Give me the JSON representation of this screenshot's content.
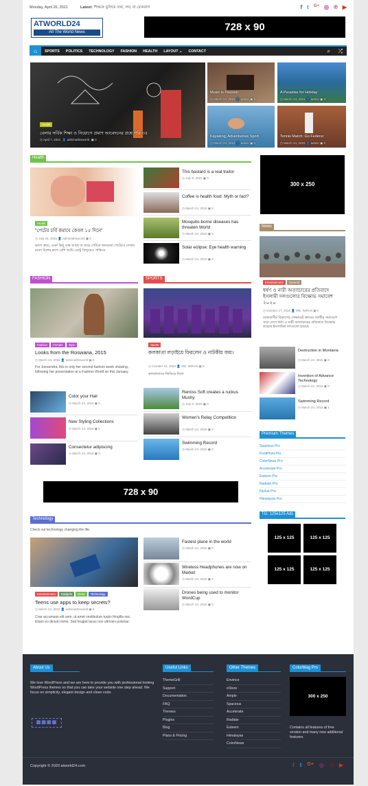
{
  "topbar": {
    "date": "Monday, April 26, 2021",
    "latest_label": "Latest:",
    "latest_text": "শিক্ষকে ভুলিয়ে তথ্য, লন, রা চ্যেকবাল"
  },
  "logo": {
    "name": "ATWORLD24",
    "tagline": "All The World News"
  },
  "ads": {
    "top": "728 x 90",
    "mid": "728 x 90",
    "side": "300 x 250",
    "footer": "300 x 250",
    "small": "125 x 125"
  },
  "nav": {
    "items": [
      "SPORTS",
      "POLITICS",
      "TECHNOLOGY",
      "FASHION",
      "HEALTH",
      "LAYOUT ⌄",
      "CONTACT"
    ]
  },
  "hero": {
    "main": {
      "badge": "Health",
      "title": "বেলার সর্বিক শিক্ষা ও নিয়োগে প্রমাণ আবেদনের প্রশ্নে পরি ৩৫",
      "date": "April 7, 2021",
      "author": "adminathisworld",
      "comments": "0"
    },
    "tiles": [
      {
        "title": "Music is Passion",
        "date": "March 24, 2015",
        "author": "admin",
        "comments": "0"
      },
      {
        "title": "A Paradise for Holiday",
        "date": "March 24, 2015",
        "author": "admin",
        "comments": "0"
      },
      {
        "title": "Kayaking, Adventurous Sport",
        "date": "March 24, 2015",
        "author": "admin",
        "comments": "0"
      },
      {
        "title": "Tennis Match: Go Federer",
        "date": "March 24, 2015",
        "author": "admin",
        "comments": "0"
      }
    ]
  },
  "health": {
    "title": "Health",
    "main": {
      "badge": "Health",
      "title": "\"পেটের চর্বি কমাবে কেবল ১৫ দিনে\"",
      "date": "July 26, 2020",
      "author": "adminathisworld",
      "comments": "0",
      "excerpt": "ভাতা ক্রমে, এমন কিছু ব্যস্ত আছে যা রুড়ে পেটকে অনবরত পেটেরও দেখার মতো বিশেষ রুপে বেশি আমি একটু বিন্দুকেও পাকিয়ে"
    },
    "list": [
      {
        "title": "This bastard is a real traitor",
        "date": "July 9, 2020",
        "comments": "0"
      },
      {
        "title": "Coffee is health food: Myth or fact?",
        "date": "March 24, 2015",
        "comments": "5"
      },
      {
        "title": "Mosquito-borne diseases has threaten World",
        "date": "March 24, 2015",
        "comments": "0"
      },
      {
        "title": "Solar eclipse: Eye health warning",
        "date": "March 24, 2015",
        "comments": "0"
      }
    ]
  },
  "news": {
    "title": "News",
    "main": {
      "badges": [
        "Entertainment",
        "General"
      ],
      "title": "ধর্ষণ ও নারী অত্যাচারের প্রতিবাদে ইসলামী দলগুলোর বিক্ষোভ সমাবেশ ২০২০",
      "date": "October 17, 2020",
      "author": "MD. IMRAN",
      "comments": "0",
      "excerpt": "ঢাকাবাসীর বিভাগের ফেভারেট ক্রাবের জাতীয় সমাবেশে সারা দেশে ধর্ষণ ও নারী অত্যাচারের প্রতিবাদে বিক্ষোভ করেছে ইসলামিক দলগুলো হয়েছে"
    },
    "list": [
      {
        "title": "Destruction in Montania",
        "date": "March 24, 2015",
        "comments": "0"
      },
      {
        "title": "Invention of Advance Technology",
        "date": "March 24, 2015",
        "comments": "0"
      },
      {
        "title": "Swimming Record",
        "date": "March 24, 2015",
        "comments": "1"
      }
    ]
  },
  "fashion": {
    "title": "FASHION",
    "main": {
      "badges": [
        "Fashion",
        "Female",
        "Style"
      ],
      "title": "Looks from the Roswana, 2015",
      "date": "March 24, 2015",
      "author": "adminathisworld",
      "comments": "0",
      "excerpt": "For Joesendra, this is only her second fashion week showing, following her presentation at a Fashion World on this January."
    },
    "list": [
      {
        "title": "Color your Hair",
        "date": "March 24, 2015",
        "comments": "0"
      },
      {
        "title": "New Styling Collections",
        "date": "March 24, 2015",
        "comments": "0"
      },
      {
        "title": "Consectetur adipiscing",
        "date": "March 24, 2015",
        "comments": "0"
      }
    ]
  },
  "sports": {
    "title": "SPORTS",
    "main": {
      "badge": "Sports",
      "title": "কলকাতা লড়াইয়ে ফিরলেন ও নাটকীয় জয়।",
      "date": "October 10, 2020",
      "author": "MD. IMRAN",
      "comments": "0",
      "excerpt": "কলকাতাকে জিতিয়ে দিলে"
    },
    "list": [
      {
        "title": "Remiss Soft creates a ruckus Mushy",
        "date": "July 6, 2020",
        "comments": "0"
      },
      {
        "title": "Women's Relay Competition",
        "date": "March 24, 2015",
        "comments": "0"
      },
      {
        "title": "Swimming Record",
        "date": "March 24, 2015",
        "comments": "0"
      }
    ]
  },
  "premium": {
    "title": "Premium Themes",
    "items": [
      "Spacious Pro",
      "FoodHunt Pro",
      "ColorNews Pro",
      "Accelerate Pro",
      "Esteem Pro",
      "Radiate Pro",
      "Fitclub Pro",
      "Himalayas Pro"
    ]
  },
  "ads_widget": {
    "title": "TG: 125x125 Ads"
  },
  "technology": {
    "title": "Technology",
    "intro": "Check out technology changing the life.",
    "main": {
      "badges": [
        "Entertainment",
        "Gadgets",
        "News",
        "Technology"
      ],
      "title": "Teens use apps to keep secrets?",
      "date": "March 24, 2015",
      "author": "adminathisworld",
      "comments": "0",
      "excerpt": "Cras accumsan elit sem, ut amet vestibulum turpis fringilla nec. Etiam eu dictum tortor. Sed feugiat lacus non ultricies pulvinar."
    },
    "list": [
      {
        "title": "Fastest plane in the world",
        "date": "March 24, 2015",
        "comments": "0"
      },
      {
        "title": "Wireless Headphones are now on Market",
        "date": "March 24, 2015",
        "comments": "0"
      },
      {
        "title": "Drones being used to monitor WordCup",
        "date": "March 24, 2015",
        "comments": "0"
      }
    ]
  },
  "footer": {
    "about_title": "About Us",
    "about_text": "We love WordPress and we are here to provide you with professional looking WordPress themes so that you can take your website one step ahead. We focus on simplicity, elegant design and clean code.",
    "links_title": "Useful Links",
    "links": [
      "ThemeGrill",
      "Support",
      "Documentation",
      "FAQ",
      "Themes",
      "Plugins",
      "Blog",
      "Plans & Pricing"
    ],
    "themes_title": "Other Themes",
    "themes": [
      "Envince",
      "eStore",
      "Ample",
      "Spacious",
      "Accelerate",
      "Radiate",
      "Esteem",
      "Himalayas",
      "ColorNews"
    ],
    "colormag_title": "ColorMag Pro",
    "colormag_text": "Contains all features of free version and many new additional features.",
    "copyright": "Copyright © 2020 atworld24.com"
  },
  "colors": {
    "accent": "#1e90d4",
    "health": "#6ec44a",
    "news": "#a8906c",
    "fashion": "#c04fd0",
    "sports": "#e44d4d",
    "technology": "#5a6fd0"
  }
}
